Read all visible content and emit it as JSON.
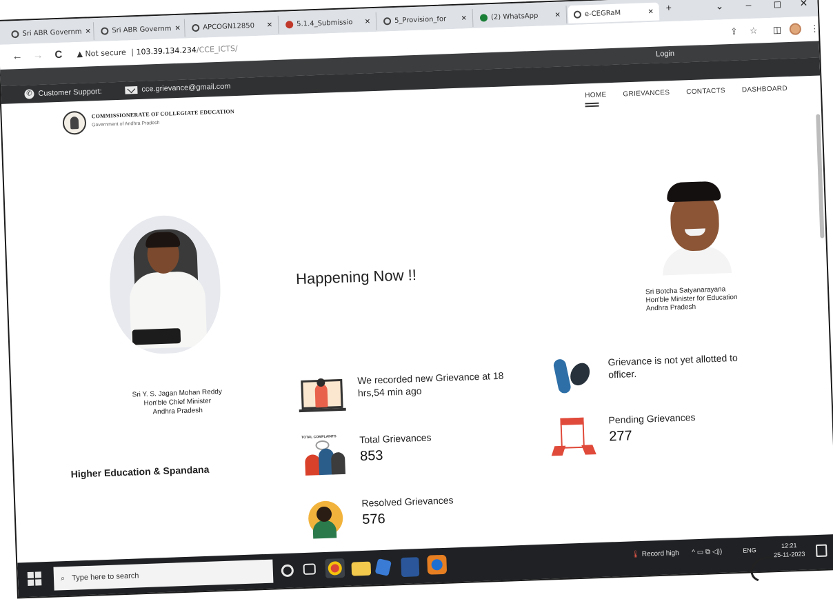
{
  "browser": {
    "tabs": [
      {
        "label": "Sri ABR Governm",
        "close": "✕",
        "icon": "globe-icon"
      },
      {
        "label": "Sri ABR Governm",
        "close": "✕",
        "icon": "globe-icon"
      },
      {
        "label": "APCOGN12850",
        "close": "✕",
        "icon": "globe-icon"
      },
      {
        "label": "5.1.4_Submissio",
        "close": "✕",
        "icon": "pdf-icon"
      },
      {
        "label": "5_Provision_for",
        "close": "✕",
        "icon": "globe-icon"
      },
      {
        "label": "(2) WhatsApp",
        "close": "✕",
        "icon": "whatsapp-icon"
      },
      {
        "label": "e-CEGRaM",
        "close": "✕",
        "icon": "globe-icon"
      }
    ],
    "new_tab": "+",
    "window_controls": {
      "dropdown": "⌄",
      "minimize": "–",
      "maximize": "◻",
      "close": "✕"
    },
    "nav": {
      "back": "←",
      "forward": "→",
      "reload": "C"
    },
    "address": {
      "warning": "▲ Not secure",
      "separator": "|",
      "host": "103.39.134.234",
      "path": "/CCE_ICTS/"
    },
    "toolbar_icons": {
      "share": "⇪",
      "bookmark": "☆",
      "sidebar": "◫",
      "menu": "⋮"
    }
  },
  "site": {
    "login": "Login",
    "support_label": "Customer Support:",
    "email": "cce.grievance@gmail.com",
    "org_name": "COMMISSIONERATE OF COLLEGIATE EDUCATION",
    "org_sub": "Government of Andhra Pradesh",
    "nav": [
      "HOME",
      "GRIEVANCES",
      "CONTACTS",
      "DASHBOARD"
    ]
  },
  "left_person": {
    "name": "Sri Y. S. Jagan Mohan Reddy",
    "title": "Hon'ble Chief Minister",
    "state": "Andhra Pradesh"
  },
  "section_label": "Higher Education & Spandana",
  "right_person": {
    "name": "Sri Botcha Satyanarayana",
    "title": "Hon'ble Minister for Education",
    "state": "Andhra Pradesh"
  },
  "happening": {
    "heading": "Happening Now !!",
    "recent": "We recorded new Grievance at 18 hrs,54 min ago",
    "not_allotted": "Grievance is not yet allotted to officer.",
    "total_label": "Total Grievances",
    "total_value": "853",
    "total_icon_caption": "TOTAL COMPLAINTS",
    "pending_label": "Pending Grievances",
    "pending_value": "277",
    "resolved_label": "Resolved Grievances",
    "resolved_value": "576"
  },
  "taskbar": {
    "search_placeholder": "Type here to search",
    "search_icon": "⌕",
    "weather": "Record high",
    "tray": "^  ▭  ⧉  ◁))",
    "lang": "ENG",
    "time": "12:21",
    "date": "25-11-2023"
  }
}
